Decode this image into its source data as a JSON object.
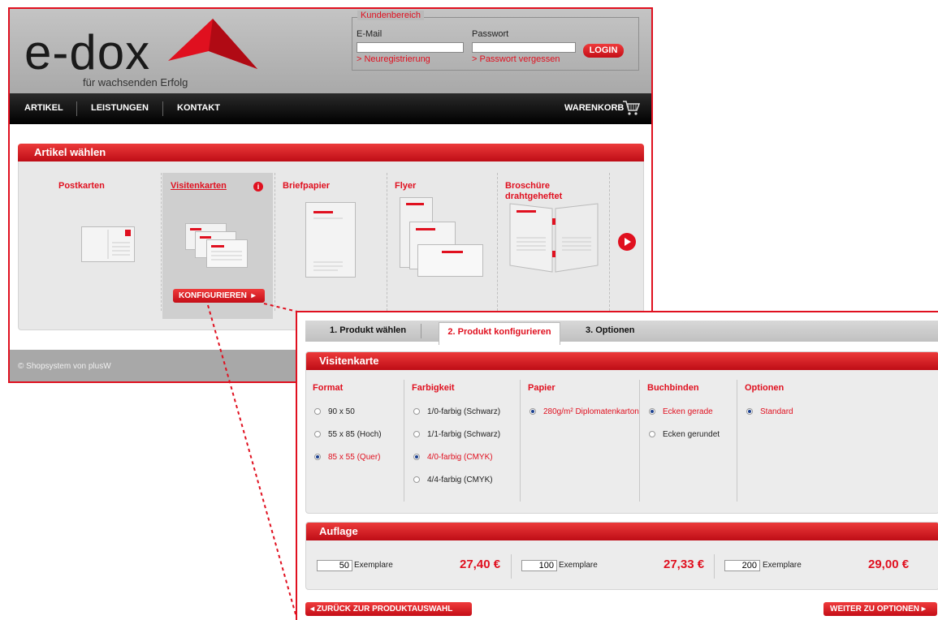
{
  "header": {
    "logo": "e-dox",
    "slogan": "für wachsenden Erfolg",
    "login": {
      "legend": "Kundenbereich",
      "email_label": "E-Mail",
      "email_value": "",
      "password_label": "Passwort",
      "password_value": "",
      "register_link": "> Neuregistrierung",
      "forgot_link": "> Passwort vergessen",
      "login_button": "LOGIN"
    }
  },
  "nav": {
    "items": [
      "ARTIKEL",
      "LEISTUNGEN",
      "KONTAKT"
    ],
    "cart": "WARENKORB",
    "cart_icon": "cart-icon"
  },
  "artikel": {
    "title": "Artikel wählen",
    "products": [
      {
        "label": "Postkarten"
      },
      {
        "label": "Visitenkarten",
        "selected": true
      },
      {
        "label": "Briefpapier"
      },
      {
        "label": "Flyer"
      },
      {
        "label": "Broschüre\ndrahtgeheftet"
      }
    ],
    "configure_button": "KONFIGURIEREN"
  },
  "footer": {
    "text": "© Shopsystem von plusW"
  },
  "config": {
    "tabs": [
      "1. Produkt wählen",
      "2. Produkt konfigurieren",
      "3. Optionen"
    ],
    "active_tab": 1,
    "product_title": "Visitenkarte",
    "columns": [
      {
        "head": "Format",
        "options": [
          {
            "label": "90 x 50",
            "selected": false
          },
          {
            "label": "55 x 85 (Hoch)",
            "selected": false
          },
          {
            "label": "85 x 55 (Quer)",
            "selected": true
          }
        ]
      },
      {
        "head": "Farbigkeit",
        "options": [
          {
            "label": "1/0-farbig (Schwarz)",
            "selected": false
          },
          {
            "label": "1/1-farbig (Schwarz)",
            "selected": false
          },
          {
            "label": "4/0-farbig (CMYK)",
            "selected": true
          },
          {
            "label": "4/4-farbig (CMYK)",
            "selected": false
          }
        ]
      },
      {
        "head": "Papier",
        "options": [
          {
            "label": "280g/m² Diplomatenkarton",
            "selected": true
          }
        ]
      },
      {
        "head": "Buchbinden",
        "options": [
          {
            "label": "Ecken gerade",
            "selected": true
          },
          {
            "label": "Ecken gerundet",
            "selected": false
          }
        ]
      },
      {
        "head": "Optionen",
        "options": [
          {
            "label": "Standard",
            "selected": true
          }
        ]
      }
    ],
    "auflage": {
      "title": "Auflage",
      "unit": "Exemplare",
      "items": [
        {
          "qty": "50",
          "price": "27,40 €"
        },
        {
          "qty": "100",
          "price": "27,33 €"
        },
        {
          "qty": "200",
          "price": "29,00 €"
        }
      ]
    },
    "back_button": "ZURÜCK ZUR PRODUKTAUSWAHL",
    "forward_button": "WEITER ZU OPTIONEN"
  },
  "colors": {
    "accent": "#e0101f",
    "header_bg": "#b5b5b5",
    "nav_bg": "#111111"
  }
}
